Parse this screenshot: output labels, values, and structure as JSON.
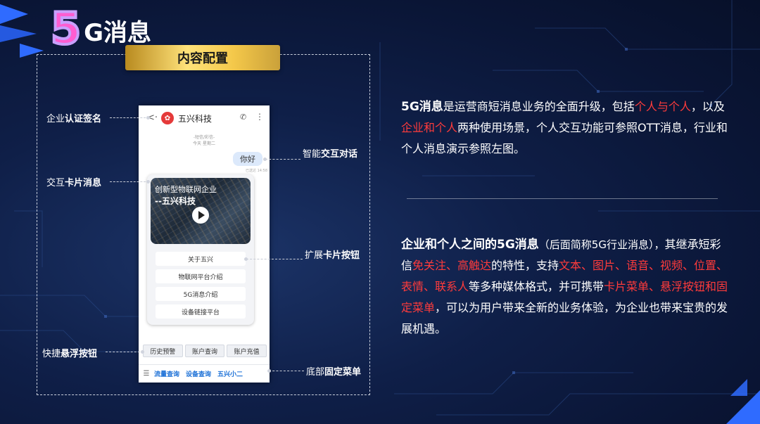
{
  "title": {
    "big_digit": "5",
    "rest": "G消息"
  },
  "banner": {
    "label": "内容配置"
  },
  "callouts": {
    "auth": [
      "企业",
      "认证签名"
    ],
    "card": [
      "交互",
      "卡片消息"
    ],
    "float": [
      "快捷",
      "悬浮按钮"
    ],
    "dialog": [
      "智能",
      "交互对话"
    ],
    "cardbtn": [
      "扩展",
      "卡片按钮"
    ],
    "menu": [
      "底部",
      "固定菜单"
    ]
  },
  "phone": {
    "back": "<·",
    "logo": "✿",
    "brand": "五兴科技",
    "phone_icon": "✆",
    "more_icon": "⋮",
    "meta_line1": "-短信/彩信-",
    "meta_line2": "今天 星期二",
    "bubble": "你好",
    "bubble_time": "已送达 14:58",
    "video_line1": "创新型物联网企业",
    "video_line2": "--五兴科技",
    "card_buttons": [
      "关于五兴",
      "物联网平台介绍",
      "5G消息介绍",
      "设备链接平台"
    ],
    "float_buttons": [
      "历史预警",
      "账户查询",
      "账户充值"
    ],
    "menu_icon": "☰",
    "menu_items": [
      "流量查询",
      "设备查询",
      "五兴小二"
    ]
  },
  "para1": {
    "t1": "5G消息",
    "t2": "是运营商短消息业务的全面升级，包括",
    "t3": "个人与个人",
    "t4": "，以及",
    "t5": "企业和个人",
    "t6": "两种使用场景，个人交互功能可参照OTT消息，行业和个人消息演示参照左图。"
  },
  "para2": {
    "t1": "企业和个人之间的5G消息",
    "t2": "（后面简称5G行业消息），",
    "t3": "其继承短彩信",
    "t4": "免关注、高触达",
    "t5": "的特性，支持",
    "t6": "文本、图片、语音、视频、位置、表情、联系人",
    "t7": "等多种媒体格式，并可携带",
    "t8": "卡片菜单、悬浮按钮和固定菜单",
    "t9": "，可以为用户带来全新的业务体验，为企业也带来宝贵的发展机遇。"
  }
}
